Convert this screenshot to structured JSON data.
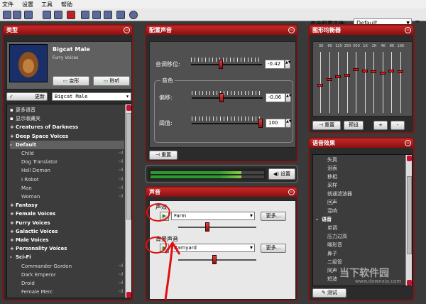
{
  "menu": [
    "文件",
    "设置",
    "工具",
    "帮助"
  ],
  "toolbar": {
    "profile_label": "声音配置文件:",
    "profile_value": "Default"
  },
  "type_panel": {
    "title": "类型",
    "voice_name": "Bigcat Male",
    "voice_category": "Furry Voices",
    "morph_button": "变形",
    "listen_button": "聆听",
    "update_button": "更新",
    "voice_select": "Bigcat Male",
    "list": [
      {
        "text": "更多语音",
        "kind": "link"
      },
      {
        "text": "显示收藏夹",
        "kind": "link"
      },
      {
        "text": "Creatures of Darkness",
        "kind": "cat",
        "pm": "+"
      },
      {
        "text": "Deep Space Voices",
        "kind": "cat",
        "pm": "+"
      },
      {
        "text": "Default",
        "kind": "cat",
        "pm": "-",
        "sel": true
      },
      {
        "text": "Child",
        "kind": "sub"
      },
      {
        "text": "Dog Translator",
        "kind": "sub"
      },
      {
        "text": "Hell Demon",
        "kind": "sub"
      },
      {
        "text": "I Robot",
        "kind": "sub"
      },
      {
        "text": "Man",
        "kind": "sub"
      },
      {
        "text": "Woman",
        "kind": "sub"
      },
      {
        "text": "Fantasy",
        "kind": "cat",
        "pm": "+"
      },
      {
        "text": "Female Voices",
        "kind": "cat",
        "pm": "+"
      },
      {
        "text": "Furry Voices",
        "kind": "cat",
        "pm": "+"
      },
      {
        "text": "Galactic Voices",
        "kind": "cat",
        "pm": "+"
      },
      {
        "text": "Male Voices",
        "kind": "cat",
        "pm": "+"
      },
      {
        "text": "Personality Voices",
        "kind": "cat",
        "pm": "+"
      },
      {
        "text": "Sci-Fi",
        "kind": "cat",
        "pm": "-"
      },
      {
        "text": "Commander Gordon",
        "kind": "sub"
      },
      {
        "text": "Dark Emperor",
        "kind": "sub"
      },
      {
        "text": "Droid",
        "kind": "sub"
      },
      {
        "text": "Female Merc",
        "kind": "sub"
      }
    ]
  },
  "config_panel": {
    "title": "配置声音",
    "pitch_label": "音调移位:",
    "pitch_value": "-0.42",
    "timbre_group": "音色",
    "offset_label": "偏移:",
    "offset_value": "-0.06",
    "threshold_label": "阈值:",
    "threshold_value": "100",
    "reset_button": "重置",
    "levels": {
      "pitch": 0.42,
      "offset": 0.41,
      "threshold": 1.0
    }
  },
  "meter_panel": {
    "settings_button": "设置",
    "level": 0.6
  },
  "sound_panel": {
    "title": "声音",
    "sound1_label": "声效",
    "sound1_value": "Farm",
    "more1": "更多...",
    "sound2_label": "背景声音",
    "sound2_value": "Barnyard",
    "more2": "更多..."
  },
  "eq_panel": {
    "title": "图形均衡器",
    "bands": [
      "30",
      "60",
      "125",
      "250",
      "500",
      "1K",
      "2K",
      "4K",
      "8K",
      "16K"
    ],
    "levels": [
      0.45,
      0.55,
      0.6,
      0.62,
      0.72,
      0.7,
      0.68,
      0.66,
      0.7,
      0.68
    ],
    "reset_button": "重置",
    "preset_button": "预设",
    "plus_button": "+",
    "minus_button": "-"
  },
  "effects_panel": {
    "title": "语音效果",
    "items": [
      "失真",
      "泪表",
      "移相",
      "采样",
      "就通滤波器",
      "回声",
      "混响",
      "语音",
      "单调",
      "压力过高",
      "喉形音",
      "鼻子",
      "二级管",
      "同声",
      "短波"
    ],
    "test_button": "测试"
  },
  "watermark": "当下软件园",
  "watermark_url": "www.downxia.com"
}
